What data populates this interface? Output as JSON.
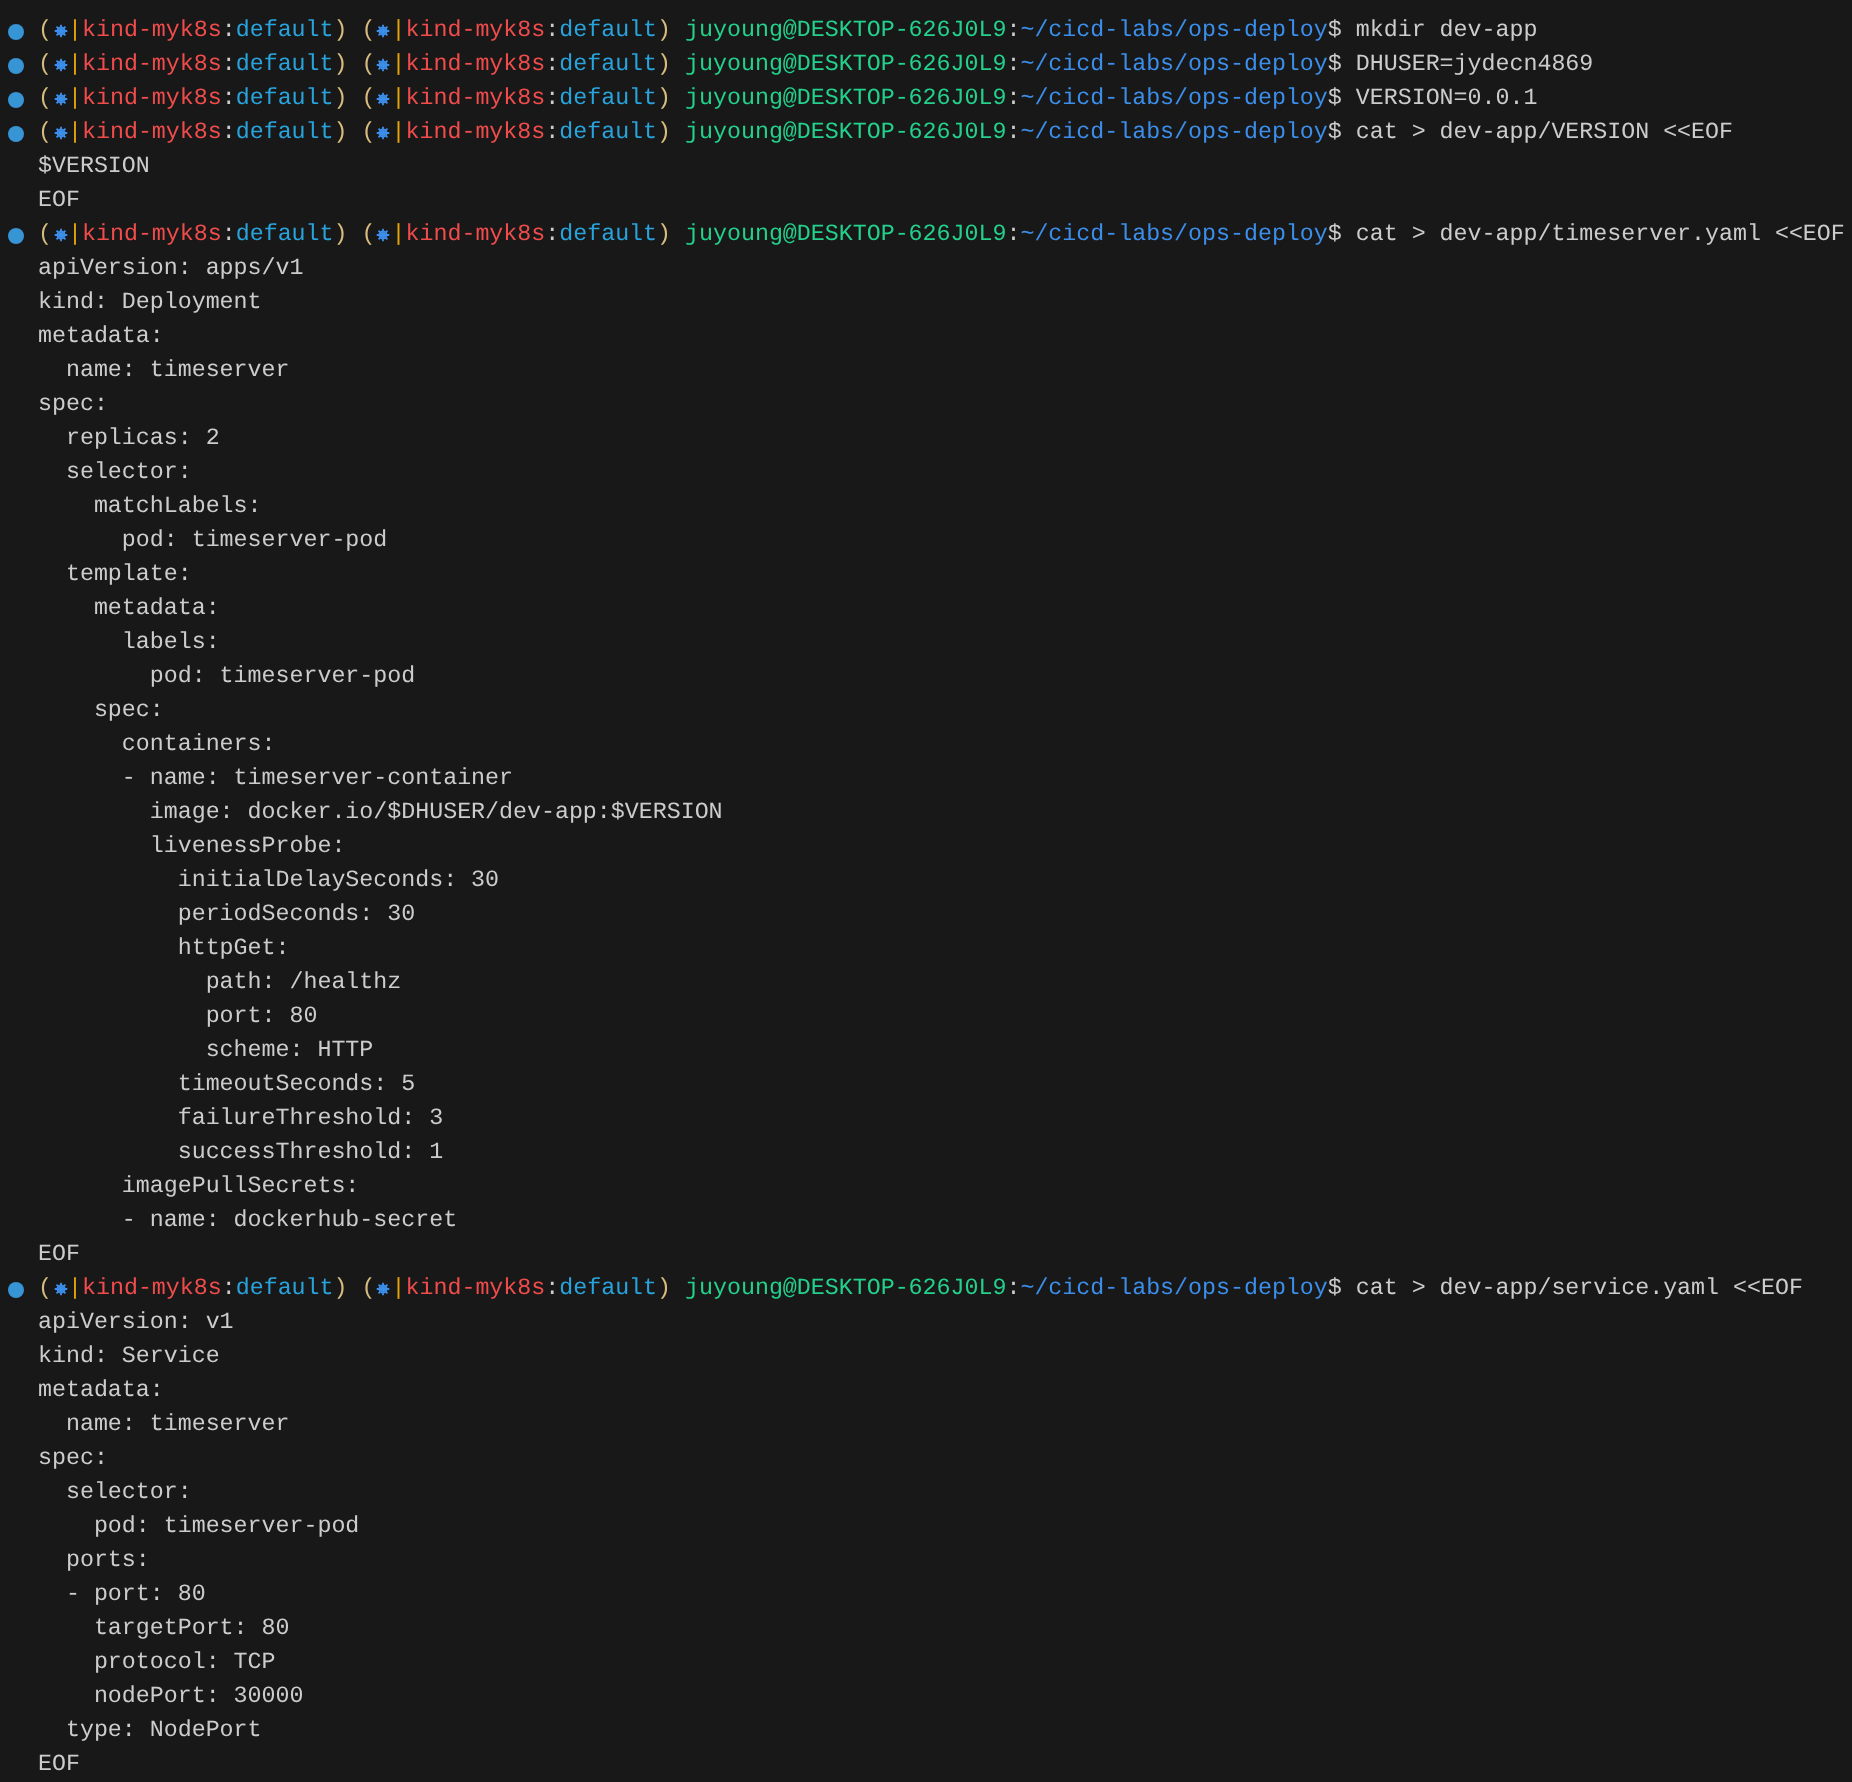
{
  "terminal": {
    "lines": [
      {
        "kind": "prompt",
        "contexts": [
          {
            "open": "(",
            "pipe": "|",
            "cluster": "kind-myk8s",
            "colon": ":",
            "namespace": "default",
            "close": ")"
          },
          {
            "open": "(",
            "pipe": "|",
            "cluster": "kind-myk8s",
            "colon": ":",
            "namespace": "default",
            "close": ")"
          }
        ],
        "user_host": "juyoung@DESKTOP-626J0L9",
        "host_sep": ":",
        "path": "~/cicd-labs/ops-deploy",
        "dollar": "$",
        "command": "mkdir dev-app"
      },
      {
        "kind": "prompt",
        "contexts": [
          {
            "open": "(",
            "pipe": "|",
            "cluster": "kind-myk8s",
            "colon": ":",
            "namespace": "default",
            "close": ")"
          },
          {
            "open": "(",
            "pipe": "|",
            "cluster": "kind-myk8s",
            "colon": ":",
            "namespace": "default",
            "close": ")"
          }
        ],
        "user_host": "juyoung@DESKTOP-626J0L9",
        "host_sep": ":",
        "path": "~/cicd-labs/ops-deploy",
        "dollar": "$",
        "command": "DHUSER=jydecn4869"
      },
      {
        "kind": "prompt",
        "contexts": [
          {
            "open": "(",
            "pipe": "|",
            "cluster": "kind-myk8s",
            "colon": ":",
            "namespace": "default",
            "close": ")"
          },
          {
            "open": "(",
            "pipe": "|",
            "cluster": "kind-myk8s",
            "colon": ":",
            "namespace": "default",
            "close": ")"
          }
        ],
        "user_host": "juyoung@DESKTOP-626J0L9",
        "host_sep": ":",
        "path": "~/cicd-labs/ops-deploy",
        "dollar": "$",
        "command": "VERSION=0.0.1"
      },
      {
        "kind": "prompt",
        "contexts": [
          {
            "open": "(",
            "pipe": "|",
            "cluster": "kind-myk8s",
            "colon": ":",
            "namespace": "default",
            "close": ")"
          },
          {
            "open": "(",
            "pipe": "|",
            "cluster": "kind-myk8s",
            "colon": ":",
            "namespace": "default",
            "close": ")"
          }
        ],
        "user_host": "juyoung@DESKTOP-626J0L9",
        "host_sep": ":",
        "path": "~/cicd-labs/ops-deploy",
        "dollar": "$",
        "command": "cat > dev-app/VERSION <<EOF"
      },
      {
        "kind": "output",
        "text": "$VERSION"
      },
      {
        "kind": "output",
        "text": "EOF"
      },
      {
        "kind": "prompt",
        "contexts": [
          {
            "open": "(",
            "pipe": "|",
            "cluster": "kind-myk8s",
            "colon": ":",
            "namespace": "default",
            "close": ")"
          },
          {
            "open": "(",
            "pipe": "|",
            "cluster": "kind-myk8s",
            "colon": ":",
            "namespace": "default",
            "close": ")"
          }
        ],
        "user_host": "juyoung@DESKTOP-626J0L9",
        "host_sep": ":",
        "path": "~/cicd-labs/ops-deploy",
        "dollar": "$",
        "command": "cat > dev-app/timeserver.yaml <<EOF"
      },
      {
        "kind": "output",
        "text": "apiVersion: apps/v1"
      },
      {
        "kind": "output",
        "text": "kind: Deployment"
      },
      {
        "kind": "output",
        "text": "metadata:"
      },
      {
        "kind": "output",
        "text": "  name: timeserver"
      },
      {
        "kind": "output",
        "text": "spec:"
      },
      {
        "kind": "output",
        "text": "  replicas: 2"
      },
      {
        "kind": "output",
        "text": "  selector:"
      },
      {
        "kind": "output",
        "text": "    matchLabels:"
      },
      {
        "kind": "output",
        "text": "      pod: timeserver-pod"
      },
      {
        "kind": "output",
        "text": "  template:"
      },
      {
        "kind": "output",
        "text": "    metadata:"
      },
      {
        "kind": "output",
        "text": "      labels:"
      },
      {
        "kind": "output",
        "text": "        pod: timeserver-pod"
      },
      {
        "kind": "output",
        "text": "    spec:"
      },
      {
        "kind": "output",
        "text": "      containers:"
      },
      {
        "kind": "output",
        "text": "      - name: timeserver-container"
      },
      {
        "kind": "output",
        "text": "        image: docker.io/$DHUSER/dev-app:$VERSION"
      },
      {
        "kind": "output",
        "text": "        livenessProbe:"
      },
      {
        "kind": "output",
        "text": "          initialDelaySeconds: 30"
      },
      {
        "kind": "output",
        "text": "          periodSeconds: 30"
      },
      {
        "kind": "output",
        "text": "          httpGet:"
      },
      {
        "kind": "output",
        "text": "            path: /healthz"
      },
      {
        "kind": "output",
        "text": "            port: 80"
      },
      {
        "kind": "output",
        "text": "            scheme: HTTP"
      },
      {
        "kind": "output",
        "text": "          timeoutSeconds: 5"
      },
      {
        "kind": "output",
        "text": "          failureThreshold: 3"
      },
      {
        "kind": "output",
        "text": "          successThreshold: 1"
      },
      {
        "kind": "output",
        "text": "      imagePullSecrets:"
      },
      {
        "kind": "output",
        "text": "      - name: dockerhub-secret"
      },
      {
        "kind": "output",
        "text": "EOF"
      },
      {
        "kind": "prompt",
        "contexts": [
          {
            "open": "(",
            "pipe": "|",
            "cluster": "kind-myk8s",
            "colon": ":",
            "namespace": "default",
            "close": ")"
          },
          {
            "open": "(",
            "pipe": "|",
            "cluster": "kind-myk8s",
            "colon": ":",
            "namespace": "default",
            "close": ")"
          }
        ],
        "user_host": "juyoung@DESKTOP-626J0L9",
        "host_sep": ":",
        "path": "~/cicd-labs/ops-deploy",
        "dollar": "$",
        "command": "cat > dev-app/service.yaml <<EOF"
      },
      {
        "kind": "output",
        "text": "apiVersion: v1"
      },
      {
        "kind": "output",
        "text": "kind: Service"
      },
      {
        "kind": "output",
        "text": "metadata:"
      },
      {
        "kind": "output",
        "text": "  name: timeserver"
      },
      {
        "kind": "output",
        "text": "spec:"
      },
      {
        "kind": "output",
        "text": "  selector:"
      },
      {
        "kind": "output",
        "text": "    pod: timeserver-pod"
      },
      {
        "kind": "output",
        "text": "  ports:"
      },
      {
        "kind": "output",
        "text": "  - port: 80"
      },
      {
        "kind": "output",
        "text": "    targetPort: 80"
      },
      {
        "kind": "output",
        "text": "    protocol: TCP"
      },
      {
        "kind": "output",
        "text": "    nodePort: 30000"
      },
      {
        "kind": "output",
        "text": "  type: NodePort"
      },
      {
        "kind": "output",
        "text": "EOF"
      }
    ]
  }
}
